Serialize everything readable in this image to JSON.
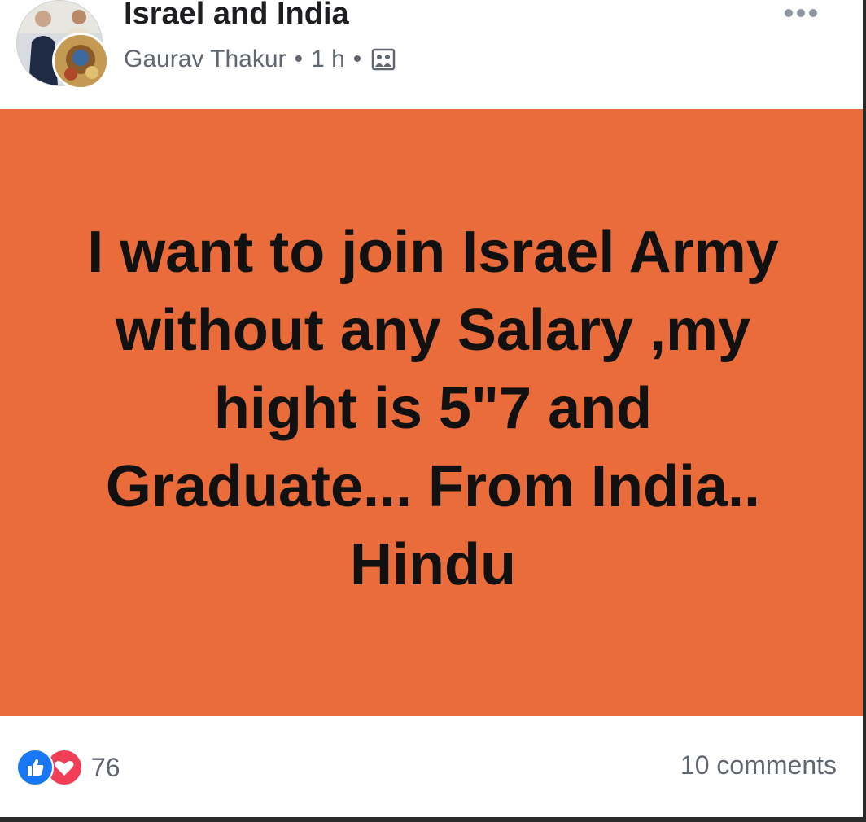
{
  "post": {
    "group_name": "Israel and India",
    "author": "Gaurav Thakur",
    "separator": "•",
    "time": "1 h",
    "privacy_icon": "group-privacy-icon",
    "more_icon": "more-options-icon",
    "background_color": "#e96c3a",
    "text_lines": [
      "I want to join Israel Army",
      "without any Salary ,my",
      "hight is 5\"7 and",
      "Graduate... From India..",
      "Hindu"
    ]
  },
  "footer": {
    "reaction_icons": [
      "like-icon",
      "love-icon"
    ],
    "reaction_count": "76",
    "comments": "10 comments"
  }
}
